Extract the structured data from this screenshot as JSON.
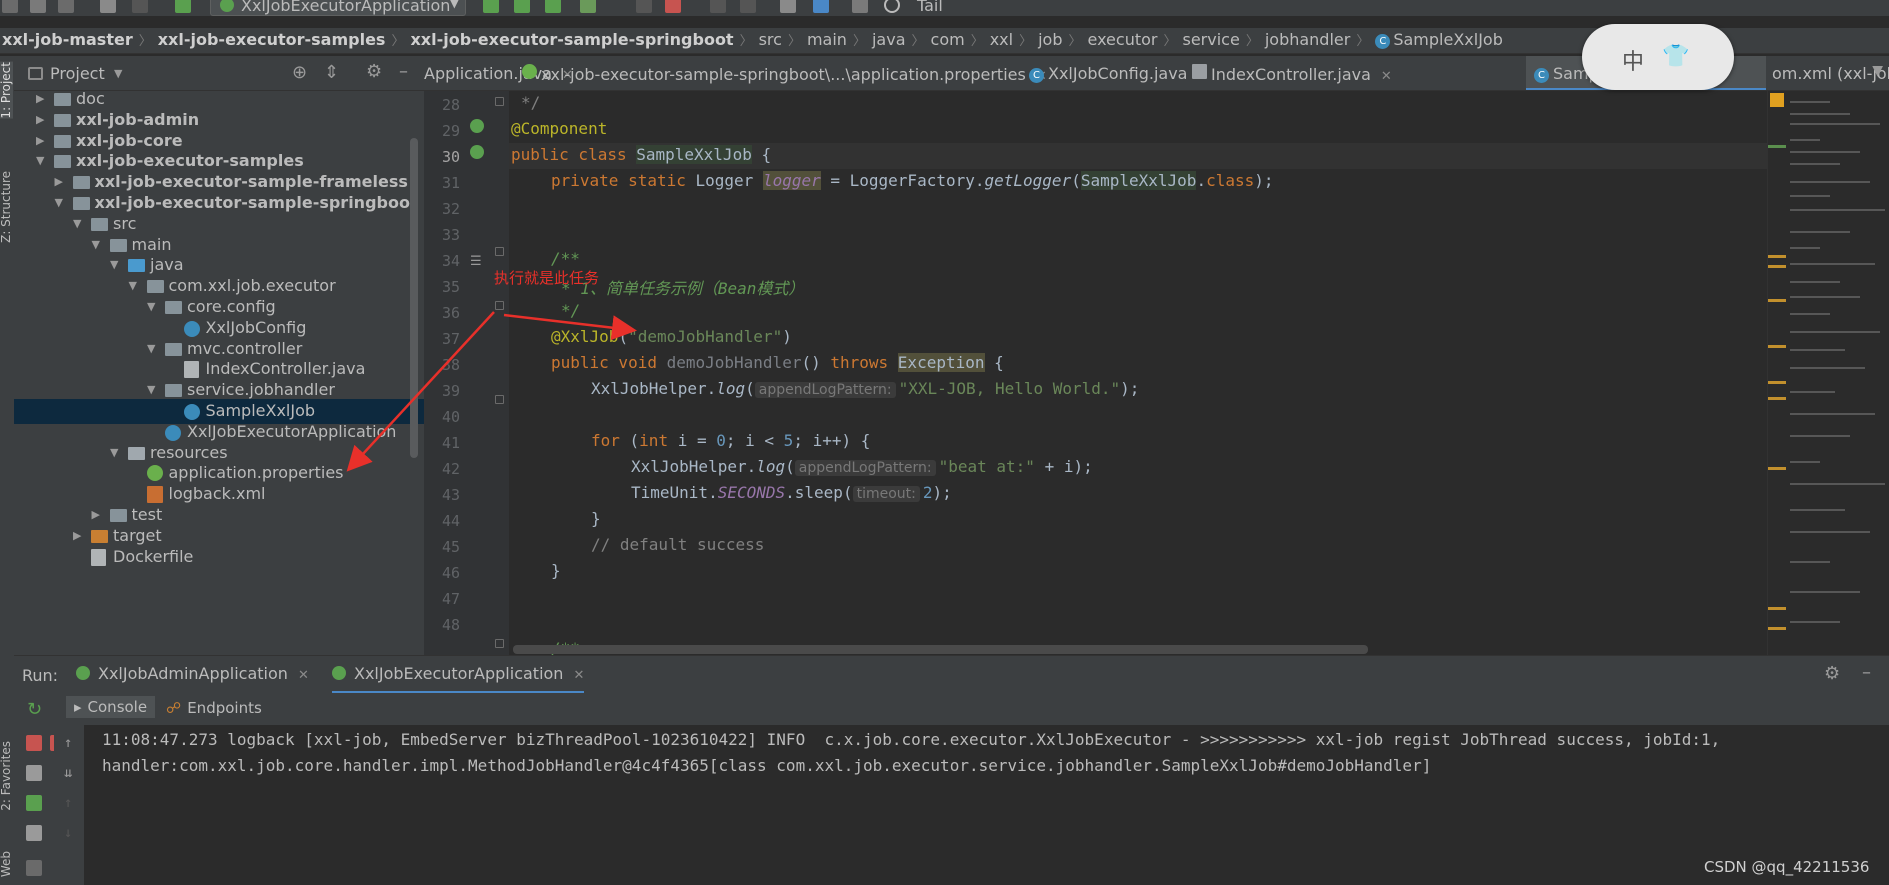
{
  "toolbar": {
    "run_config": "XxlJobExecutorApplication",
    "tail": "Tail"
  },
  "breadcrumb": [
    {
      "label": "xxl-job-master",
      "bold": true
    },
    {
      "label": "xxl-job-executor-samples",
      "bold": true
    },
    {
      "label": "xxl-job-executor-sample-springboot",
      "bold": true
    },
    {
      "label": "src",
      "bold": false
    },
    {
      "label": "main",
      "bold": false
    },
    {
      "label": "java",
      "bold": false
    },
    {
      "label": "com",
      "bold": false
    },
    {
      "label": "xxl",
      "bold": false
    },
    {
      "label": "job",
      "bold": false
    },
    {
      "label": "executor",
      "bold": false
    },
    {
      "label": "service",
      "bold": false
    },
    {
      "label": "jobhandler",
      "bold": false
    },
    {
      "label": "SampleXxlJob",
      "bold": false
    }
  ],
  "left_strip": {
    "project": "1: Project",
    "structure": "Z: Structure",
    "favorites": "2: Favorites",
    "web": "Web"
  },
  "project_panel": {
    "title": "Project",
    "tree": [
      {
        "label": "doc",
        "indent": 0,
        "arrow": "right",
        "icon": "folder",
        "bold": false
      },
      {
        "label": "xxl-job-admin",
        "indent": 0,
        "arrow": "right",
        "icon": "folder",
        "bold": true
      },
      {
        "label": "xxl-job-core",
        "indent": 0,
        "arrow": "right",
        "icon": "folder",
        "bold": true
      },
      {
        "label": "xxl-job-executor-samples",
        "indent": 0,
        "arrow": "down",
        "icon": "folder",
        "bold": true
      },
      {
        "label": "xxl-job-executor-sample-frameless",
        "indent": 1,
        "arrow": "right",
        "icon": "folder",
        "bold": true
      },
      {
        "label": "xxl-job-executor-sample-springboot",
        "indent": 1,
        "arrow": "down",
        "icon": "folder",
        "bold": true
      },
      {
        "label": "src",
        "indent": 2,
        "arrow": "down",
        "icon": "folder",
        "bold": false
      },
      {
        "label": "main",
        "indent": 3,
        "arrow": "down",
        "icon": "folder",
        "bold": false
      },
      {
        "label": "java",
        "indent": 4,
        "arrow": "down",
        "icon": "folder-blue",
        "bold": false
      },
      {
        "label": "com.xxl.job.executor",
        "indent": 5,
        "arrow": "down",
        "icon": "package",
        "bold": false
      },
      {
        "label": "core.config",
        "indent": 6,
        "arrow": "down",
        "icon": "package",
        "bold": false
      },
      {
        "label": "XxlJobConfig",
        "indent": 7,
        "arrow": "",
        "icon": "class",
        "bold": false
      },
      {
        "label": "mvc.controller",
        "indent": 6,
        "arrow": "down",
        "icon": "package",
        "bold": false
      },
      {
        "label": "IndexController.java",
        "indent": 7,
        "arrow": "",
        "icon": "file",
        "bold": false
      },
      {
        "label": "service.jobhandler",
        "indent": 6,
        "arrow": "down",
        "icon": "package",
        "bold": false
      },
      {
        "label": "SampleXxlJob",
        "indent": 7,
        "arrow": "",
        "icon": "class",
        "bold": false,
        "selected": true
      },
      {
        "label": "XxlJobExecutorApplication",
        "indent": 6,
        "arrow": "",
        "icon": "class",
        "bold": false
      },
      {
        "label": "resources",
        "indent": 4,
        "arrow": "down",
        "icon": "folder-res",
        "bold": false
      },
      {
        "label": "application.properties",
        "indent": 5,
        "arrow": "",
        "icon": "leaf",
        "bold": false
      },
      {
        "label": "logback.xml",
        "indent": 5,
        "arrow": "",
        "icon": "xml",
        "bold": false
      },
      {
        "label": "test",
        "indent": 3,
        "arrow": "right",
        "icon": "folder",
        "bold": false
      },
      {
        "label": "target",
        "indent": 2,
        "arrow": "right",
        "icon": "folder-orange",
        "bold": false
      },
      {
        "label": "Dockerfile",
        "indent": 2,
        "arrow": "",
        "icon": "file",
        "bold": false
      }
    ]
  },
  "tabs": [
    {
      "label": "Application.java",
      "icon": "class",
      "active": false
    },
    {
      "label": "xxl-job-executor-sample-springboot\\...\\application.properties",
      "icon": "leaf",
      "active": false
    },
    {
      "label": "XxlJobConfig.java",
      "icon": "class",
      "active": false
    },
    {
      "label": "IndexController.java",
      "icon": "file",
      "active": false
    },
    {
      "label": "SampleXx",
      "icon": "class",
      "active": true
    },
    {
      "label": "om.xml (xxl-job-e",
      "icon": "",
      "active": false
    }
  ],
  "editor": {
    "line_numbers": [
      "28",
      "29",
      "30",
      "31",
      "32",
      "33",
      "34",
      "35",
      "36",
      "37",
      "38",
      "39",
      "40",
      "41",
      "42",
      "43",
      "44",
      "45",
      "46",
      "47",
      "48"
    ],
    "current_line": "30",
    "code": {
      "l28": "*/",
      "l29": "@Component",
      "l30_kw": "public class ",
      "l30_name": "SampleXxlJob",
      "l30_rest": " {",
      "l31_kw": "private static ",
      "l31_type": "Logger ",
      "l31_field": "logger",
      "l31_eq": " = LoggerFactory.",
      "l31_m": "getLogger",
      "l31_p": "(",
      "l31_cls": "SampleXxlJob",
      "l31_dot": ".",
      "l31_kwcls": "class",
      "l31_end": ");",
      "l34": "/**",
      "l35": "* 1、简单任务示例（Bean模式）",
      "l36": "*/",
      "l37_ann": "@XxlJob",
      "l37_p": "(",
      "l37_str": "\"demoJobHandler\"",
      "l37_end": ")",
      "l38_kw": "public void ",
      "l38_name": "demoJobHandler",
      "l38_p": "() ",
      "l38_kw2": "throws ",
      "l38_exc": "Exception",
      "l38_end": " {",
      "l39_a": "XxlJobHelper.",
      "l39_m": "log",
      "l39_p": "(",
      "l39_hint": "appendLogPattern:",
      "l39_str": "\"XXL-JOB, Hello World.\"",
      "l39_end": ");",
      "l41_kw": "for ",
      "l41_a": "(",
      "l41_kw2": "int ",
      "l41_b": "i = ",
      "l41_n0": "0",
      "l41_c": "; i < ",
      "l41_n5": "5",
      "l41_d": "; i++) {",
      "l42_a": "XxlJobHelper.",
      "l42_m": "log",
      "l42_p": "(",
      "l42_hint": "appendLogPattern:",
      "l42_str": "\"beat at:\"",
      "l42_end": " + i);",
      "l43_a": "TimeUnit.",
      "l43_f": "SECONDS",
      "l43_b": ".sleep(",
      "l43_hint": "timeout:",
      "l43_n": "2",
      "l43_end": ");",
      "l44": "}",
      "l45": "// default success",
      "l46": "}",
      "l49": "/**"
    }
  },
  "annotation": {
    "text": "执行就是此任务",
    "color": "#e8302a"
  },
  "ime": {
    "label": "中"
  },
  "run_panel": {
    "label": "Run:",
    "tabs": [
      {
        "label": "XxlJobAdminApplication",
        "active": false
      },
      {
        "label": "XxlJobExecutorApplication",
        "active": true
      }
    ],
    "sub_tabs": [
      {
        "label": "Console",
        "active": true
      },
      {
        "label": "Endpoints",
        "active": false
      }
    ],
    "console_lines": [
      "11:08:47.273 logback [xxl-job, EmbedServer bizThreadPool-1023610422] INFO  c.x.job.core.executor.XxlJobExecutor - >>>>>>>>>>> xxl-job regist JobThread success, jobId:1,",
      "handler:com.xxl.job.core.handler.impl.MethodJobHandler@4c4f4365[class com.xxl.job.executor.service.jobhandler.SampleXxlJob#demoJobHandler]"
    ]
  },
  "watermark": "CSDN @qq_42211536",
  "colors": {
    "accent": "#4a88c7",
    "bg": "#2b2b2b",
    "panel": "#3c3f41"
  }
}
